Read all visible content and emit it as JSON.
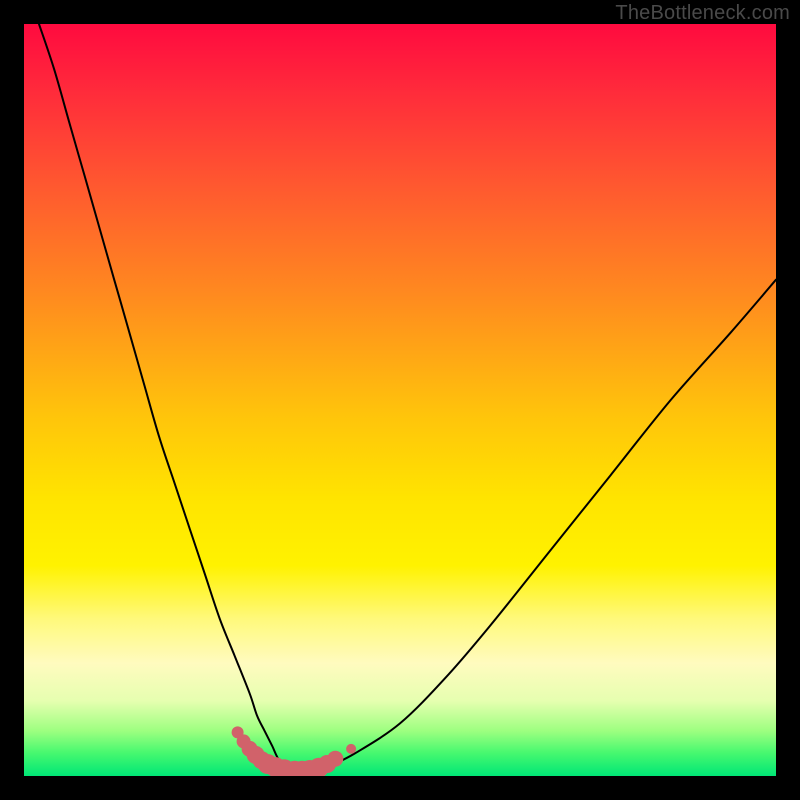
{
  "watermark": "TheBottleneck.com",
  "colors": {
    "frame_bg_top": "#ff0a3f",
    "frame_bg_bottom": "#00e676",
    "curve": "#000000",
    "marker": "#d1626a",
    "outer_bg": "#000000"
  },
  "chart_data": {
    "type": "line",
    "title": "",
    "xlabel": "",
    "ylabel": "",
    "xlim": [
      0,
      100
    ],
    "ylim": [
      0,
      100
    ],
    "grid": false,
    "series": [
      {
        "name": "bottleneck-curve",
        "x": [
          2,
          4,
          6,
          8,
          10,
          12,
          14,
          16,
          18,
          20,
          22,
          24,
          26,
          28,
          30,
          31,
          32,
          33,
          34,
          36,
          38,
          40,
          44,
          50,
          56,
          62,
          70,
          78,
          86,
          94,
          100
        ],
        "y": [
          100,
          94,
          87,
          80,
          73,
          66,
          59,
          52,
          45,
          39,
          33,
          27,
          21,
          16,
          11,
          8,
          6,
          4,
          2,
          0,
          0,
          1,
          3,
          7,
          13,
          20,
          30,
          40,
          50,
          59,
          66
        ]
      }
    ],
    "markers": {
      "name": "highlight-dots",
      "x": [
        28.4,
        29.2,
        30.0,
        30.8,
        31.6,
        32.4,
        33.4,
        34.6,
        36.0,
        37.0,
        38.0,
        39.2,
        40.3,
        41.4,
        43.5
      ],
      "y": [
        5.8,
        4.6,
        3.6,
        2.8,
        2.1,
        1.6,
        1.2,
        0.9,
        0.7,
        0.7,
        0.8,
        1.1,
        1.6,
        2.3,
        3.6
      ],
      "r": [
        6,
        7,
        8,
        9,
        9,
        10,
        10,
        10,
        10,
        10,
        10,
        10,
        9,
        8,
        5
      ]
    }
  }
}
